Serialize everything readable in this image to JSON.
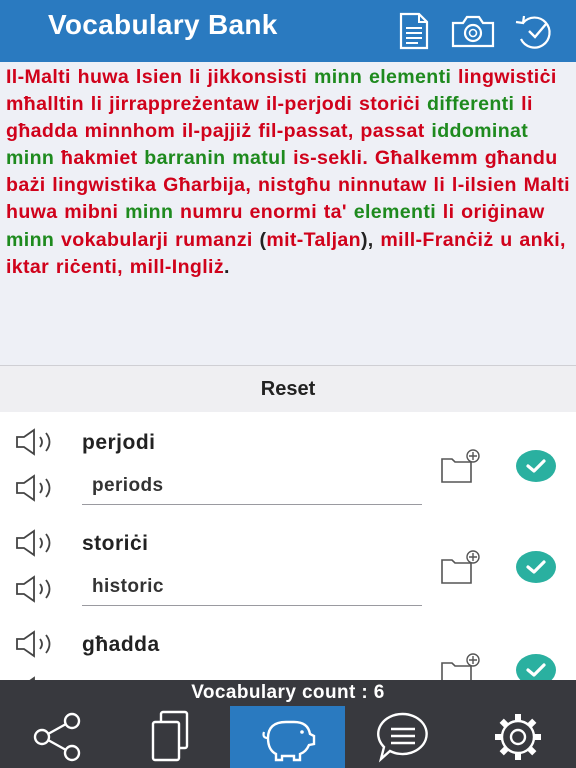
{
  "app": {
    "title": "Vocabulary Bank"
  },
  "header_icons": [
    "document-icon",
    "camera-icon",
    "history-check-icon"
  ],
  "passage": [
    {
      "t": "Il-Malti huwa lsien li jikkonsisti ",
      "c": "r"
    },
    {
      "t": "minn",
      "c": "g"
    },
    {
      "t": " ",
      "c": "r"
    },
    {
      "t": "elementi",
      "c": "g"
    },
    {
      "t": " lingwistiċi mħalltin li jirrappreżentaw il-perjodi storiċi ",
      "c": "r"
    },
    {
      "t": "differenti",
      "c": "g"
    },
    {
      "t": " li għadda minnhom il-pajjiż fil-passat, passat ",
      "c": "r"
    },
    {
      "t": "iddominat minn",
      "c": "g"
    },
    {
      "t": " ħakmiet ",
      "c": "r"
    },
    {
      "t": "barranin matul",
      "c": "g"
    },
    {
      "t": " is-sekli. Għalkemm għandu bażi lingwistika Għarbija, nistgħu ninnutaw li l-ilsien Malti huwa mibni ",
      "c": "r"
    },
    {
      "t": "minn",
      "c": "g"
    },
    {
      "t": " numru enormi ta' ",
      "c": "r"
    },
    {
      "t": "elementi",
      "c": "g"
    },
    {
      "t": " li oriġinaw ",
      "c": "r"
    },
    {
      "t": "minn",
      "c": "g"
    },
    {
      "t": " vokabularji rumanzi ",
      "c": "r"
    },
    {
      "t": "(",
      "c": "k"
    },
    {
      "t": "mit-Taljan",
      "c": "r"
    },
    {
      "t": "), ",
      "c": "k"
    },
    {
      "t": "mill-Franċiż u anki, iktar riċenti, mill-Ingliż",
      "c": "r"
    },
    {
      "t": ".",
      "c": "k"
    }
  ],
  "reset_label": "Reset",
  "vocab": [
    {
      "word": "perjodi",
      "translation": "periods"
    },
    {
      "word": "storiċi",
      "translation": "historic"
    },
    {
      "word": "għadda",
      "translation": ""
    }
  ],
  "vocabulary_count_text": "Vocabulary count : 6",
  "tabs": [
    {
      "icon": "share-icon",
      "active": false
    },
    {
      "icon": "cards-icon",
      "active": false
    },
    {
      "icon": "piggy-bank-icon",
      "active": true
    },
    {
      "icon": "chat-icon",
      "active": false
    },
    {
      "icon": "settings-icon",
      "active": false
    }
  ],
  "colors": {
    "header": "#2a7ac0",
    "red_text": "#d0021b",
    "green_text": "#1e8a1e",
    "check": "#2ab0a0",
    "bar": "#38393e"
  }
}
